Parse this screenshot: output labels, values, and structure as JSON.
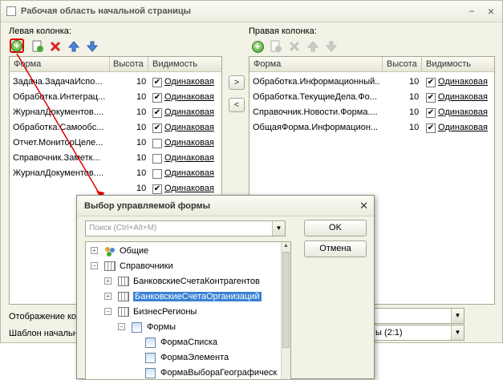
{
  "window": {
    "title": "Рабочая область начальной страницы"
  },
  "left": {
    "label": "Левая колонка:",
    "columns": [
      "Форма",
      "Высота",
      "Видимость"
    ],
    "rows": [
      {
        "form": "Задача.ЗадачаИспо...",
        "height": "10",
        "checked": true,
        "vis": "Одинаковая"
      },
      {
        "form": "Обработка.Интеграц...",
        "height": "10",
        "checked": true,
        "vis": "Одинаковая"
      },
      {
        "form": "ЖурналДокументов....",
        "height": "10",
        "checked": true,
        "vis": "Одинаковая"
      },
      {
        "form": "Обработка.Самообс...",
        "height": "10",
        "checked": true,
        "vis": "Одинаковая"
      },
      {
        "form": "Отчет.МониторЦеле...",
        "height": "10",
        "checked": false,
        "vis": "Одинаковая"
      },
      {
        "form": "Справочник.Заметк...",
        "height": "10",
        "checked": false,
        "vis": "Одинаковая"
      },
      {
        "form": "ЖурналДокументов....",
        "height": "10",
        "checked": false,
        "vis": "Одинаковая"
      },
      {
        "form": "",
        "height": "10",
        "checked": true,
        "vis": "Одинаковая"
      }
    ]
  },
  "right": {
    "label": "Правая колонка:",
    "columns": [
      "Форма",
      "Высота",
      "Видимость"
    ],
    "rows": [
      {
        "form": "Обработка.Информационный...",
        "height": "10",
        "checked": true,
        "vis": "Одинаковая"
      },
      {
        "form": "Обработка.ТекущиеДела.Фо...",
        "height": "10",
        "checked": true,
        "vis": "Одинаковая"
      },
      {
        "form": "Справочник.Новости.Форма....",
        "height": "10",
        "checked": true,
        "vis": "Одинаковая"
      },
      {
        "form": "ОбщаяФорма.Информацион...",
        "height": "10",
        "checked": true,
        "vis": "Одинаковая"
      }
    ]
  },
  "bottom": {
    "display_label": "Отображение ко",
    "template_label": "Шаблон начальн",
    "template_value": "ы (2:1)"
  },
  "dialog": {
    "title": "Выбор управляемой формы",
    "search_placeholder": "Поиск (Ctrl+Alt+M)",
    "ok": "OK",
    "cancel": "Отмена",
    "tree": [
      {
        "text": "Общие",
        "level": 0,
        "exp": "+",
        "icon": "common"
      },
      {
        "text": "Справочники",
        "level": 0,
        "exp": "−",
        "icon": "table"
      },
      {
        "text": "БанковскиеСчетаКонтрагентов",
        "level": 1,
        "exp": "+",
        "icon": "table"
      },
      {
        "text": "БанковскиеСчетаОрганизаций",
        "level": 1,
        "exp": "+",
        "icon": "table",
        "selected": true
      },
      {
        "text": "БизнесРегионы",
        "level": 1,
        "exp": "−",
        "icon": "table"
      },
      {
        "text": "Формы",
        "level": 2,
        "exp": "−",
        "icon": "form"
      },
      {
        "text": "ФормаСписка",
        "level": 3,
        "exp": "",
        "icon": "form"
      },
      {
        "text": "ФормаЭлемента",
        "level": 3,
        "exp": "",
        "icon": "form"
      },
      {
        "text": "ФормаВыбораГеографическ",
        "level": 3,
        "exp": "",
        "icon": "form"
      }
    ]
  },
  "colors": {
    "accent": "#3a82d4",
    "annotation": "#e00000",
    "green": "#3e9a2a"
  }
}
